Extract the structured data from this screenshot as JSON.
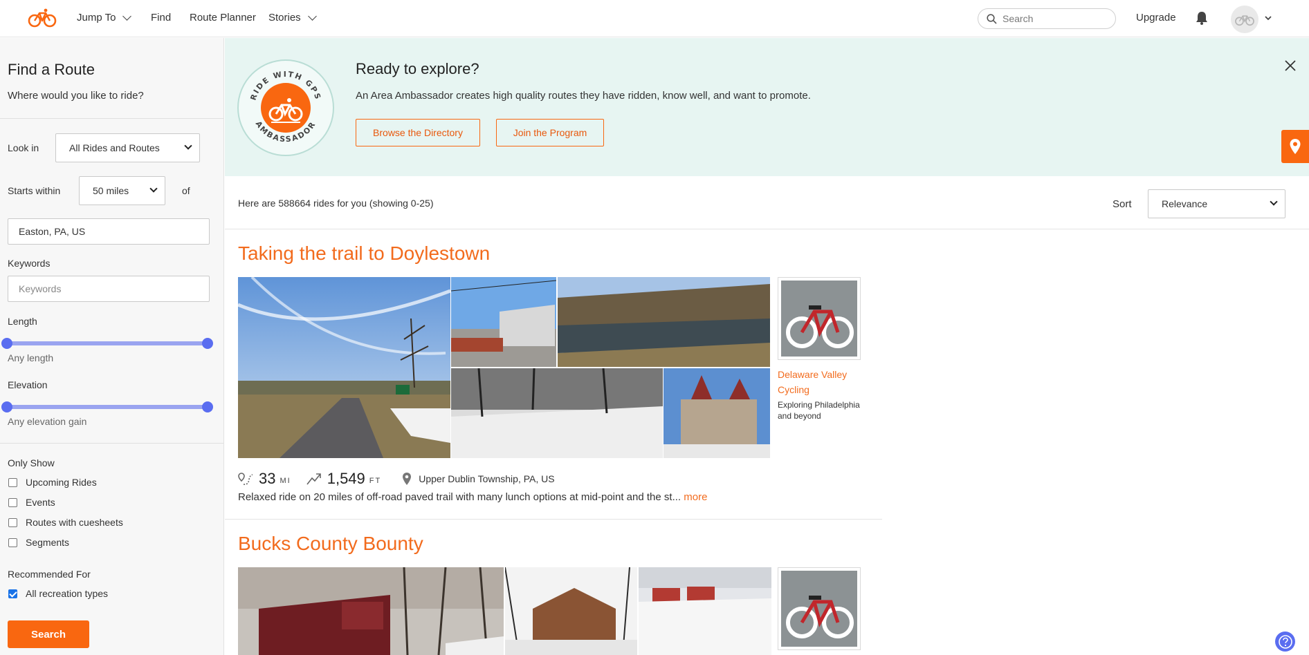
{
  "nav": {
    "items": [
      {
        "label": "Jump To",
        "has_menu": true
      },
      {
        "label": "Find",
        "has_menu": false
      },
      {
        "label": "Route Planner",
        "has_menu": false
      },
      {
        "label": "Stories",
        "has_menu": true
      }
    ],
    "search_placeholder": "Search",
    "upgrade_label": "Upgrade"
  },
  "sidebar": {
    "title": "Find a Route",
    "subtitle": "Where would you like to ride?",
    "look_in_label": "Look in",
    "look_in_value": "All Rides and Routes",
    "starts_within_label": "Starts within",
    "starts_within_value": "50 miles",
    "of_label": "of",
    "location_value": "Easton, PA, US",
    "keywords_label": "Keywords",
    "keywords_placeholder": "Keywords",
    "length_label": "Length",
    "length_hint": "Any length",
    "elevation_label": "Elevation",
    "elevation_hint": "Any elevation gain",
    "only_show_label": "Only Show",
    "only_show_options": [
      {
        "label": "Upcoming Rides",
        "checked": false
      },
      {
        "label": "Events",
        "checked": false
      },
      {
        "label": "Routes with cuesheets",
        "checked": false
      },
      {
        "label": "Segments",
        "checked": false
      }
    ],
    "recommended_label": "Recommended For",
    "recommended_options": [
      {
        "label": "All recreation types",
        "checked": true
      }
    ],
    "search_button": "Search"
  },
  "banner": {
    "badge_top_text": "RIDE WITH GPS",
    "badge_bottom_text": "AMBASSADOR",
    "title": "Ready to explore?",
    "text": "An Area Ambassador creates high quality routes they have ridden, know well, and want to promote.",
    "browse_button": "Browse the Directory",
    "join_button": "Join the Program"
  },
  "results": {
    "count_text": "Here are 588664 rides for you (showing 0-25)",
    "sort_label": "Sort",
    "sort_value": "Relevance"
  },
  "rides": [
    {
      "title": "Taking the trail to Doylestown",
      "distance": "33",
      "distance_unit": "MI",
      "elevation": "1,549",
      "elevation_unit": "FT",
      "location": "Upper Dublin Township, PA, US",
      "description": "Relaxed ride on 20 miles of off-road paved trail with many lunch options at mid-point and the st...",
      "more_label": "more",
      "owner_name": "Delaware Valley Cycling",
      "owner_desc": "Exploring Philadelphia and beyond"
    },
    {
      "title": "Bucks County Bounty"
    }
  ],
  "colors": {
    "brand_orange": "#f96710",
    "banner_bg": "#e7f5f2",
    "slider": "#5a6df0"
  }
}
